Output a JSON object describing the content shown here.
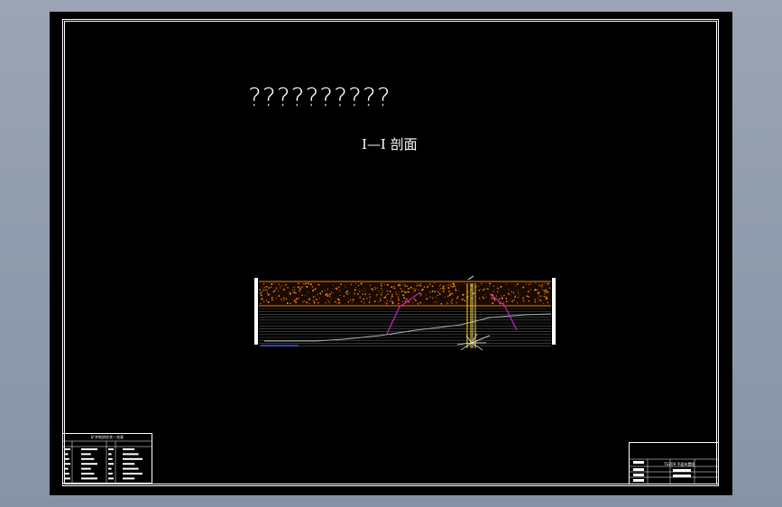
{
  "drawing": {
    "title": "??????????",
    "section_label": "I—I 剖面"
  },
  "legend": {
    "title": "矿井地质柱状一览表"
  },
  "title_block": {
    "project": "TUZ09 平面布置图"
  },
  "colors": {
    "background": "#000000",
    "frame": "#ffffff",
    "fill_dots": "#ff8c1a",
    "boundary_line": "#ff8000",
    "slope_line": "#cc22cc",
    "shaft": "#ffd700",
    "ground_line": "#b0b0b0",
    "marker": "#3050ff"
  }
}
